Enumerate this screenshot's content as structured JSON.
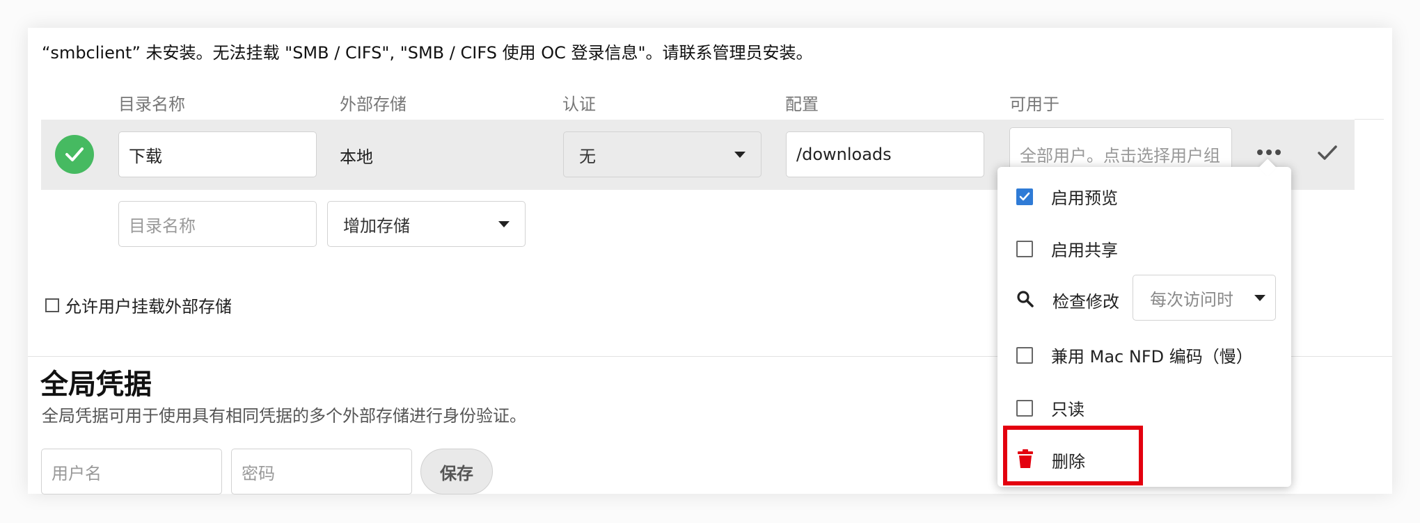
{
  "warning": "“smbclient” 未安装。无法挂载 \"SMB / CIFS\", \"SMB / CIFS 使用 OC 登录信息\"。请联系管理员安装。",
  "columns": {
    "folder_name": "目录名称",
    "external_storage": "外部存储",
    "authentication": "认证",
    "configuration": "配置",
    "available_for": "可用于"
  },
  "mount_row": {
    "folder_name": "下载",
    "storage": "本地",
    "auth": "无",
    "config": "/downloads",
    "applicable_placeholder": "全部用户。点击选择用户组"
  },
  "new_row": {
    "folder_placeholder": "目录名称",
    "add_storage": "增加存储"
  },
  "allow_user_mount": "允许用户挂载外部存储",
  "global_credentials": {
    "title": "全局凭据",
    "description": "全局凭据可用于使用具有相同凭据的多个外部存储进行身份验证。",
    "username_placeholder": "用户名",
    "password_placeholder": "密码",
    "save": "保存"
  },
  "options_menu": {
    "enable_previews": "启用预览",
    "enable_previews_checked": true,
    "enable_sharing": "启用共享",
    "enable_sharing_checked": false,
    "check_changes": "检查修改",
    "check_changes_value": "每次访问时",
    "mac_nfd": "兼用 Mac NFD 编码（慢）",
    "mac_nfd_checked": false,
    "read_only": "只读",
    "read_only_checked": false,
    "delete": "删除"
  },
  "colors": {
    "status_ok": "#46ba61",
    "checkbox_checked": "#2f7bd6",
    "delete_red": "#e3000f",
    "highlight_red": "#e3000f"
  },
  "icons": {
    "status": "checkmark-circle-icon",
    "more": "ellipsis-icon",
    "confirm": "checkmark-icon",
    "check_changes": "search-icon",
    "delete": "trash-icon"
  }
}
